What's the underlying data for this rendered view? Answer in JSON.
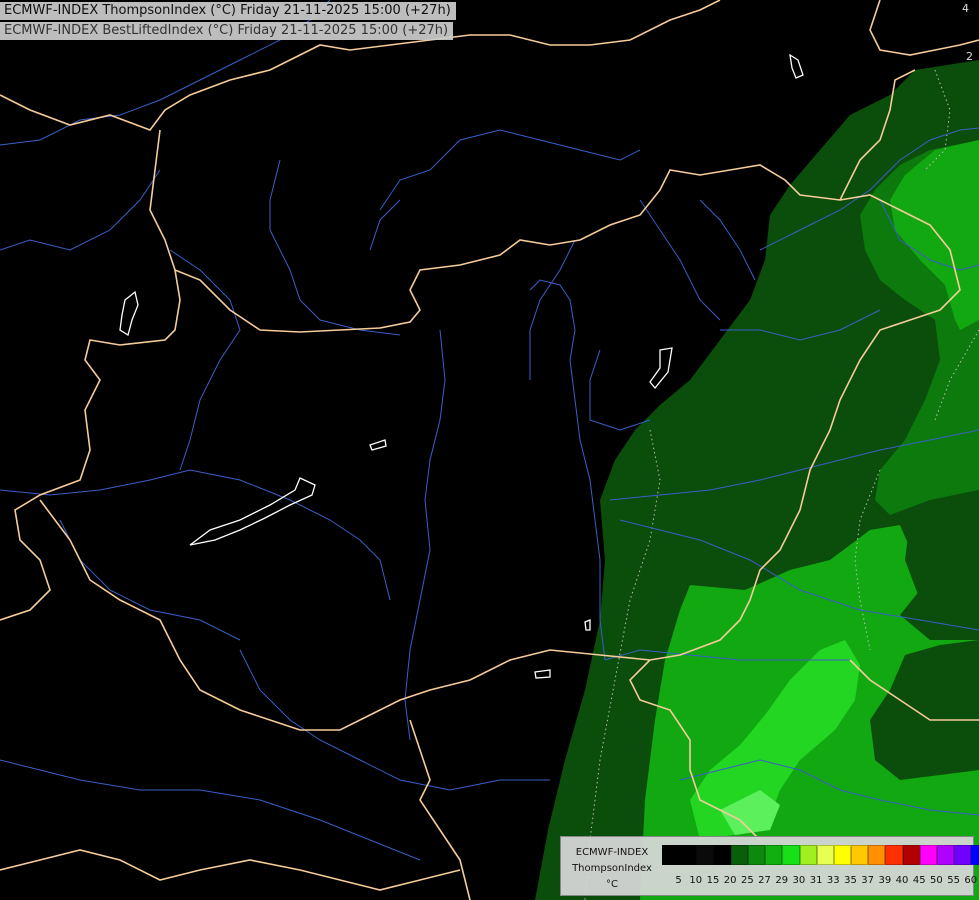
{
  "header": {
    "title_primary": "ECMWF-INDEX ThompsonIndex (°C) Friday 21-11-2025 15:00 (+27h)",
    "title_secondary": "ECMWF-INDEX BestLiftedIndex (°C) Friday 21-11-2025 15:00 (+27h)"
  },
  "legend": {
    "model": "ECMWF-INDEX",
    "variable": "ThompsonIndex",
    "unit": "°C",
    "ticks": [
      "5",
      "10",
      "15",
      "20",
      "25",
      "27",
      "29",
      "30",
      "31",
      "33",
      "35",
      "37",
      "39",
      "40",
      "45",
      "50",
      "55",
      "60"
    ],
    "colors": [
      "#000000",
      "#000000",
      "#0a0a0a",
      "#000000",
      "#0a5e0a",
      "#0d8a0d",
      "#10b010",
      "#18e018",
      "#a0f020",
      "#e6ff50",
      "#ffff00",
      "#ffc800",
      "#ff9000",
      "#ff3000",
      "#b00000",
      "#ff00ff",
      "#b000ff",
      "#7000ff",
      "#0000ff"
    ]
  },
  "map_labels": {
    "top_right_contour_a": "4",
    "top_right_contour_b": "2"
  },
  "colors": {
    "background": "#000000",
    "border_line": "#f5cc9a",
    "river_line": "#3a5fc8",
    "lake_outline": "#ffffff",
    "zone_dark_green": "#0b4d0b",
    "zone_mid_green": "#0c7a0c",
    "zone_green": "#12a812",
    "zone_bright_green": "#22d622",
    "zone_lime": "#5cf05c"
  }
}
